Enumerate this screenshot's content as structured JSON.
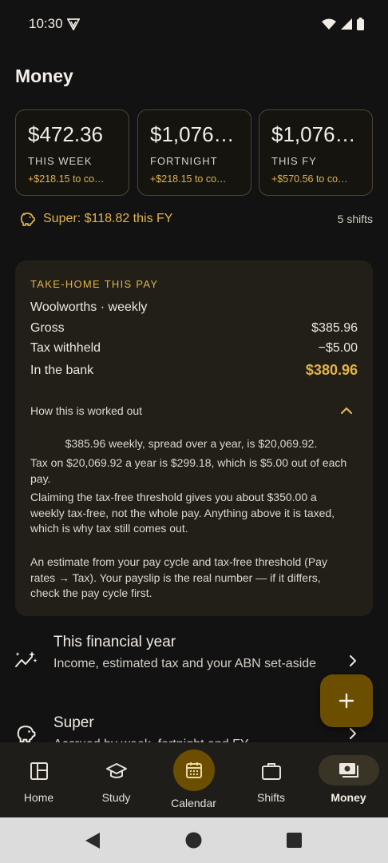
{
  "status_bar": {
    "time": "10:30"
  },
  "page": {
    "title": "Money"
  },
  "summary_cards": [
    {
      "amount": "$472.36",
      "label": "THIS WEEK",
      "delta": "+$218.15 to co…"
    },
    {
      "amount": "$1,076.…",
      "label": "FORTNIGHT",
      "delta": "+$218.15 to co…"
    },
    {
      "amount": "$1,076.…",
      "label": "THIS FY",
      "delta": "+$570.56 to co…"
    }
  ],
  "super_row": {
    "text": "Super: $118.82 this FY",
    "shifts": "5 shifts",
    "icon": "piggy-bank-icon"
  },
  "takehome": {
    "heading": "TAKE-HOME THIS PAY",
    "employer": "Woolworths · weekly",
    "rows": [
      {
        "label": "Gross",
        "value": "$385.96"
      },
      {
        "label": "Tax withheld",
        "value": "−$5.00"
      },
      {
        "label": "In the bank",
        "value": "$380.96"
      }
    ],
    "how_label": "How this is worked out",
    "explanation": [
      "$385.96 weekly, spread over a year, is $20,069.92.",
      "Tax on $20,069.92 a year is $299.18, which is $5.00 out of each pay.",
      "Claiming the tax-free threshold gives you about $350.00 a weekly tax-free, not the whole pay. Anything above it is taxed, which is why tax still comes out.",
      "An estimate from your pay cycle and tax-free threshold (Pay rates → Tax). Your payslip is the real number — if it differs, check the pay cycle first."
    ]
  },
  "list_items": [
    {
      "title": "This financial year",
      "subtitle": "Income, estimated tax and your ABN set-aside",
      "icon": "trend-sparkle-icon"
    },
    {
      "title": "Super",
      "subtitle": "Accrued by week, fortnight and FY",
      "icon": "piggy-bank-icon"
    }
  ],
  "fab": {
    "label": "+"
  },
  "bottom_nav": [
    {
      "label": "Home",
      "icon": "home-icon",
      "selected": false
    },
    {
      "label": "Study",
      "icon": "graduation-cap-icon",
      "selected": false
    },
    {
      "label": "Calendar",
      "icon": "calendar-icon",
      "selected": false
    },
    {
      "label": "Shifts",
      "icon": "briefcase-icon",
      "selected": false
    },
    {
      "label": "Money",
      "icon": "cash-icon",
      "selected": true
    }
  ],
  "colors": {
    "accent": "#e0b34b",
    "background": "#121212",
    "card": "#221f18",
    "fab": "#6b4e00"
  }
}
